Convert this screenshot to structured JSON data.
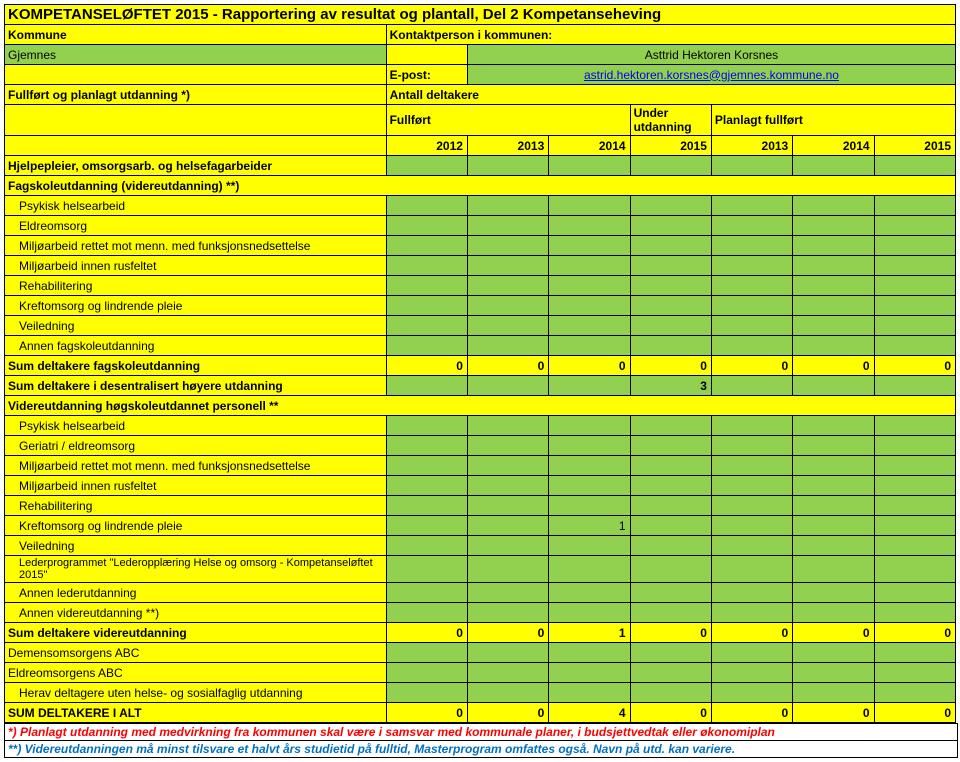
{
  "title": "KOMPETANSELØFTET 2015 - Rapportering av resultat og plantall, Del 2  Kompetanseheving",
  "labels": {
    "kommune": "Kommune",
    "kontakt": "Kontaktperson i kommunen:",
    "epost": "E-post:",
    "plan": "Fullført og planlagt utdanning *)",
    "antall": "Antall deltakere",
    "fullfort": "Fullført",
    "under": "Under utdanning",
    "planlagt": "Planlagt fullført"
  },
  "kommune_value": "Gjemnes",
  "person": "Asttrid Hektoren Korsnes",
  "email": "astrid.hektoren.korsnes@gjemnes.kommune.no",
  "years": {
    "y1": "2012",
    "y2": "2013",
    "y3": "2014",
    "y4": "2015",
    "y5": "2013",
    "y6": "2014",
    "y7": "2015"
  },
  "rows": {
    "r0": "Hjelpepleier, omsorgsarb. og helsefagarbeider",
    "r1": "Fagskoleutdanning (videreutdanning) **)",
    "r2": "Psykisk helsearbeid",
    "r3": "Eldreomsorg",
    "r4": "Miljøarbeid rettet mot menn. med funksjonsnedsettelse",
    "r5": "Miljøarbeid innen rusfeltet",
    "r6": "Rehabilitering",
    "r7": "Kreftomsorg og lindrende pleie",
    "r8": "Veiledning",
    "r9": "Annen fagskoleutdanning",
    "sum1": "Sum deltakere fagskoleutdanning",
    "sum2": "Sum deltakere i desentralisert høyere utdanning",
    "v0": "Videreutdanning høgskoleutdannet personell **",
    "v1": "Psykisk helsearbeid",
    "v2": "Geriatri / eldreomsorg",
    "v3": "Miljøarbeid rettet mot menn. med funksjonsnedsettelse",
    "v4": "Miljøarbeid innen rusfeltet",
    "v5": "Rehabilitering",
    "v6": "Kreftomsorg og lindrende pleie",
    "v7": "Veiledning",
    "v8": "Lederprogrammet \"Lederopplæring Helse og omsorg - Kompetanseløftet 2015\"",
    "v9": "Annen lederutdanning",
    "v10": "Annen videreutdanning **)",
    "sum3": "Sum deltakere videreutdanning",
    "d1": "Demensomsorgens ABC",
    "d2": "Eldreomsorgens ABC",
    "d3": "Herav deltagere uten helse- og sosialfaglig utdanning",
    "sum4": "SUM DELTAKERE I ALT"
  },
  "vals": {
    "sum1": {
      "c1": "0",
      "c2": "0",
      "c3": "0",
      "c4": "0",
      "c5": "0",
      "c6": "0",
      "c7": "0"
    },
    "sum2_c4": "3",
    "v6_c3": "1",
    "sum3": {
      "c1": "0",
      "c2": "0",
      "c3": "1",
      "c4": "0",
      "c5": "0",
      "c6": "0",
      "c7": "0"
    },
    "sum4": {
      "c1": "0",
      "c2": "0",
      "c3": "4",
      "c4": "0",
      "c5": "0",
      "c6": "0",
      "c7": "0"
    }
  },
  "footnote1": "*) Planlagt utdanning med medvirkning fra kommunen skal være i samsvar med kommunale planer, i budsjettvedtak eller økonomiplan",
  "footnote2": "**) Videreutdanningen må minst  tilsvare et halvt års studietid på fulltid, Masterprogram omfattes også. Navn på utd. kan variere."
}
